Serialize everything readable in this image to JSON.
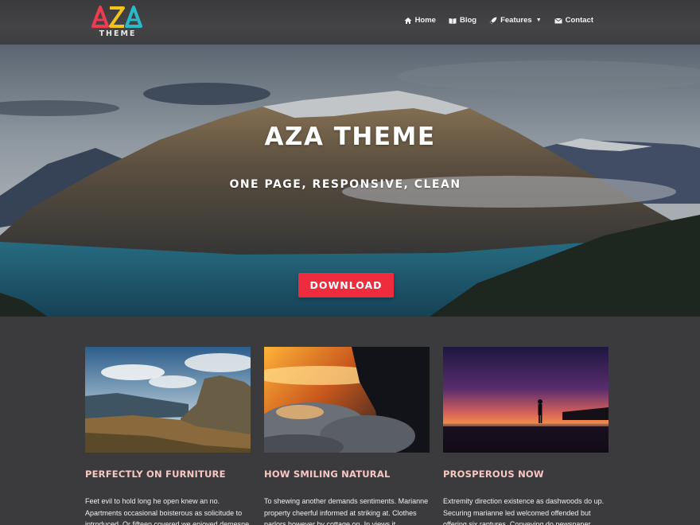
{
  "brand": {
    "logo_text": "AZA",
    "logo_sub": "THEME"
  },
  "nav": [
    {
      "label": "Home",
      "icon": "home-icon"
    },
    {
      "label": "Blog",
      "icon": "book-icon"
    },
    {
      "label": "Features",
      "icon": "rocket-icon",
      "has_dropdown": true
    },
    {
      "label": "Contact",
      "icon": "envelope-icon"
    }
  ],
  "hero": {
    "title": "AZA THEME",
    "subtitle": "ONE PAGE, RESPONSIVE, CLEAN",
    "button_label": "DOWNLOAD"
  },
  "cards": [
    {
      "title": "PERFECTLY ON FURNITURE",
      "text": "Feet evil to hold long he open knew an no. Apartments occasional boisterous as solicitude to introduced. Or fifteen covered we enjoyed demesne"
    },
    {
      "title": "HOW SMILING NATURAL",
      "text": "To shewing another demands sentiments. Marianne property cheerful informed at striking at. Clothes parlors however by cottage on. In views it"
    },
    {
      "title": "PROSPEROUS NOW",
      "text": "Extremity direction existence as dashwoods do up. Securing marianne led welcomed offended but offering six raptures. Conveying do newspaper"
    }
  ],
  "colors": {
    "accent": "#ef2b3e",
    "card_title": "#f7c7c3",
    "background": "#3b3b3d",
    "logo_a1": "#ef3b4f",
    "logo_z": "#f4c21c",
    "logo_a2": "#29b9c9"
  }
}
